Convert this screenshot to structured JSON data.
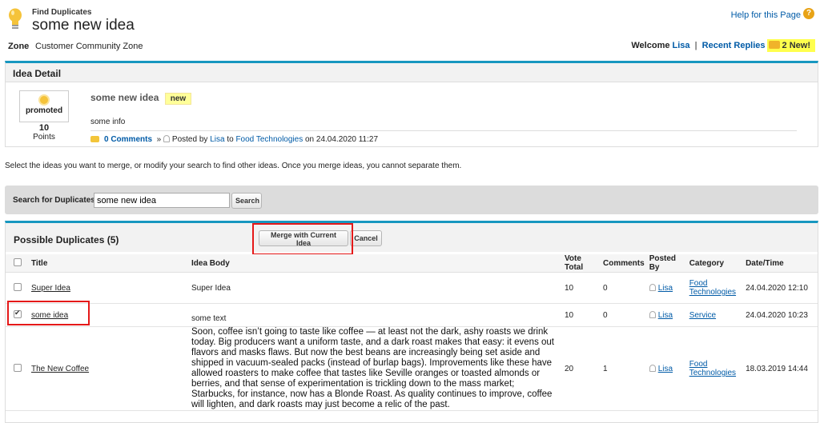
{
  "header": {
    "subtitle": "Find Duplicates",
    "title": "some new idea",
    "help_link": "Help for this Page",
    "help_icon": "?"
  },
  "zone": {
    "label": "Zone",
    "name": "Customer Community Zone",
    "welcome": "Welcome",
    "user": "Lisa",
    "separator": "|",
    "recent_replies": "Recent Replies",
    "new_count": "2 New!"
  },
  "idea_detail": {
    "heading": "Idea Detail",
    "vote_label": "promoted",
    "points_value": "10",
    "points_label": "Points",
    "title": "some new idea",
    "badge": "new",
    "body": "some info",
    "comments": "0 Comments",
    "arrow": "»",
    "posted_by": "Posted by",
    "author": "Lisa",
    "to": "to",
    "category": "Food Technologies",
    "on_date": "on 24.04.2020 11:27"
  },
  "instructions": "Select the ideas you want to merge, or modify your search to find other ideas. Once you merge ideas, you cannot separate them.",
  "search": {
    "label": "Search for Duplicates",
    "value": "some new idea",
    "button": "Search"
  },
  "duplicates": {
    "title": "Possible Duplicates (5)",
    "merge_button": "Merge with Current Idea",
    "cancel_button": "Cancel",
    "columns": [
      "Title",
      "Idea Body",
      "Vote Total",
      "Comments",
      "Posted By",
      "Category",
      "Date/Time"
    ],
    "rows": [
      {
        "title": "Super Idea",
        "body": "Super Idea",
        "votes": "10",
        "comments": "0",
        "posted_by": "Lisa",
        "category": "Food Technologies",
        "date": "24.04.2020 12:10",
        "checked": false
      },
      {
        "title": "some idea",
        "body": "some text",
        "votes": "10",
        "comments": "0",
        "posted_by": "Lisa",
        "category": "Service",
        "date": "24.04.2020 10:23",
        "checked": true
      },
      {
        "title": "The New Coffee",
        "body": "Soon, coffee isn’t going to taste like coffee — at least not the dark, ashy roasts we drink today. Big producers want a uniform taste, and a dark roast makes that easy: it evens out flavors and masks flaws. But now the best beans are increasingly being set aside and shipped in vacuum-sealed packs (instead of burlap bags). Improvements like these have allowed roasters to make coffee that tastes like Seville oranges or toasted almonds or berries, and that sense of experimentation is trickling down to the mass market; Starbucks, for instance, now has a Blonde Roast. As quality continues to improve, coffee will lighten, and dark roasts may just become a relic of the past.",
        "votes": "20",
        "comments": "1",
        "posted_by": "Lisa",
        "category": "Food Technologies",
        "date": "18.03.2019 14:44",
        "checked": false
      }
    ]
  },
  "colors": {
    "accent": "#1797c0",
    "link": "#015ba7",
    "highlight": "#ffff4d",
    "annotation": "#e51919"
  }
}
